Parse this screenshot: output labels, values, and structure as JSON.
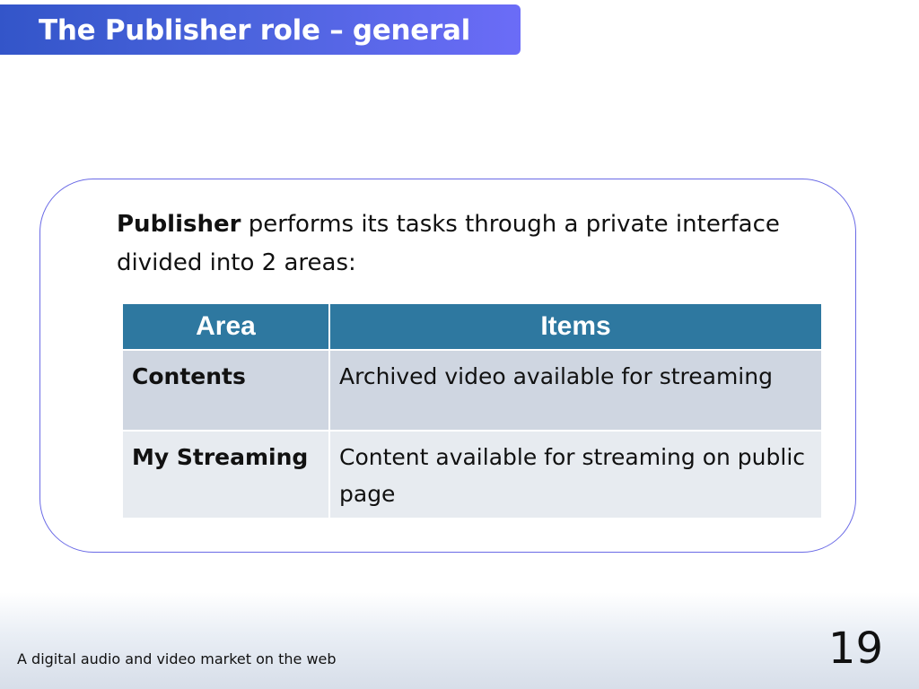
{
  "slide": {
    "title": "The Publisher role – general",
    "intro_bold": "Publisher",
    "intro_rest": " performs its tasks through a private interface divided into 2 areas:",
    "table": {
      "headers": [
        "Area",
        "Items"
      ],
      "rows": [
        {
          "area": "Contents",
          "items": "Archived video available for streaming"
        },
        {
          "area": "My Streaming",
          "items": "Content available for streaming on public page"
        }
      ]
    },
    "footer_text": "A digital audio and video market on the web",
    "page_number": "19"
  },
  "colors": {
    "title_gradient_start": "#3355c9",
    "title_gradient_end": "#6b6cf7",
    "frame_border": "#6a6ae6",
    "table_header": "#2e78a0",
    "row_dark": "#cfd6e1",
    "row_light": "#e7ebf0"
  }
}
